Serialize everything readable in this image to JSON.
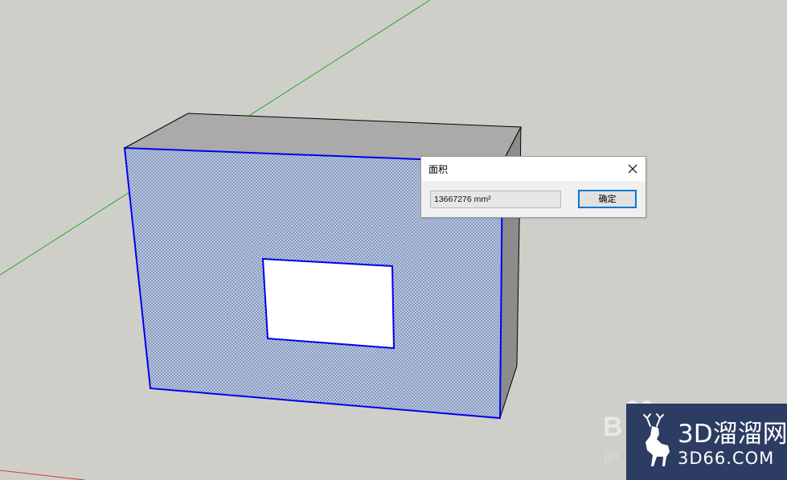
{
  "dialog": {
    "title": "面积",
    "value": "13667276 mm²",
    "ok_label": "确定",
    "close_icon": "close-icon"
  },
  "watermarks": {
    "baidu_letter": "B",
    "baidu_sub": "jin",
    "logo_brand": "3D溜溜网",
    "logo_domain": "3D66.COM"
  },
  "colors": {
    "background": "#cfcfca",
    "selected_face_fill": "#b9c3d6",
    "selection_edge": "#0000ee",
    "axis_green": "#2aa52a",
    "axis_red": "#d23a3a",
    "accent": "#0078d7",
    "logo_bg": "#2c3c63"
  }
}
